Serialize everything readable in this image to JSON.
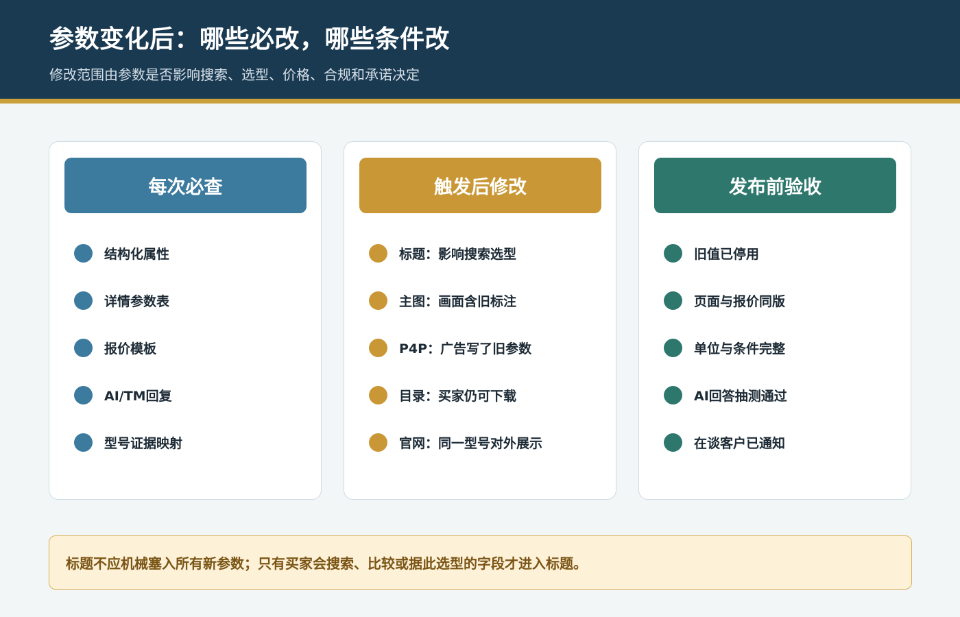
{
  "header": {
    "title": "参数变化后：哪些必改，哪些条件改",
    "subtitle": "修改范围由参数是否影响搜索、选型、价格、合规和承诺决定"
  },
  "colors": {
    "header_bg": "#1a3a52",
    "accent": "#c9a03a",
    "blue": "#3c7a9e",
    "gold": "#c99735",
    "teal": "#2e776d"
  },
  "cards": [
    {
      "title": "每次必查",
      "items": [
        "结构化属性",
        "详情参数表",
        "报价模板",
        "AI/TM回复",
        "型号证据映射"
      ]
    },
    {
      "title": "触发后修改",
      "items": [
        "标题：影响搜索选型",
        "主图：画面含旧标注",
        "P4P：广告写了旧参数",
        "目录：买家仍可下载",
        "官网：同一型号对外展示"
      ]
    },
    {
      "title": "发布前验收",
      "items": [
        "旧值已停用",
        "页面与报价同版",
        "单位与条件完整",
        "AI回答抽测通过",
        "在谈客户已通知"
      ]
    }
  ],
  "note": {
    "text": "标题不应机械塞入所有新参数；只有买家会搜索、比较或据此选型的字段才进入标题。"
  }
}
